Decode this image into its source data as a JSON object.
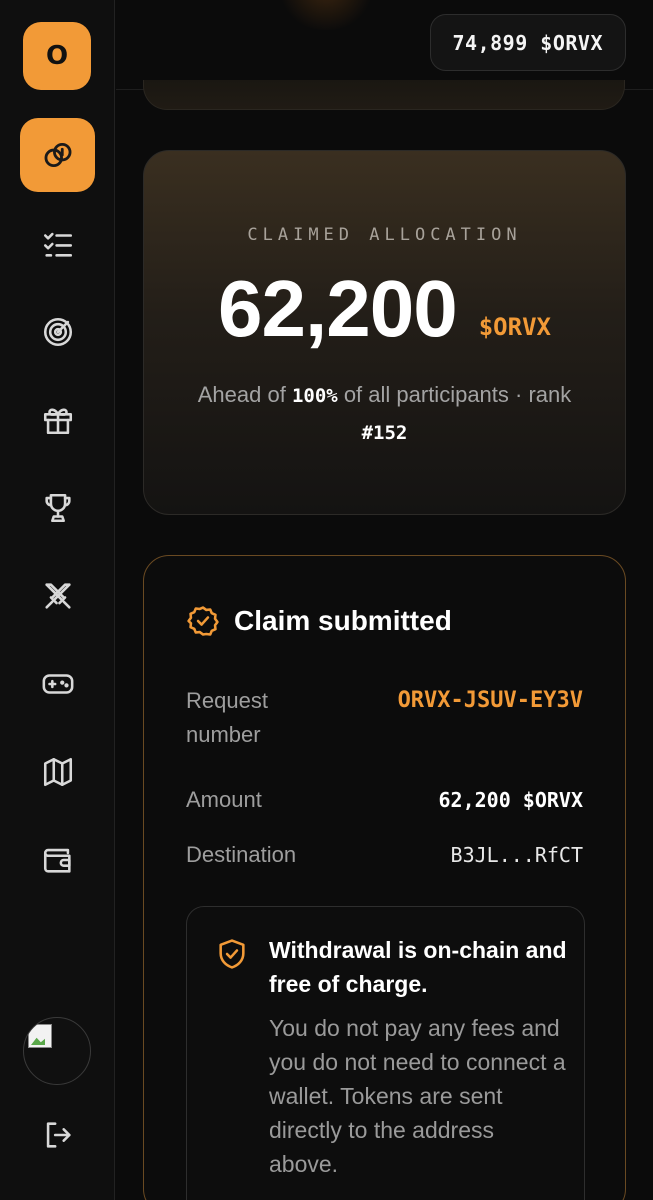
{
  "sidebar": {
    "logo_letter": "O",
    "nav": [
      {
        "icon": "link-coin-icon",
        "active": true
      },
      {
        "icon": "checklist-icon",
        "active": false
      },
      {
        "icon": "radar-icon",
        "active": false
      },
      {
        "icon": "gift-icon",
        "active": false
      },
      {
        "icon": "trophy-icon",
        "active": false
      },
      {
        "icon": "crossed-swords-icon",
        "active": false
      },
      {
        "icon": "gamepad-icon",
        "active": false
      },
      {
        "icon": "map-icon",
        "active": false
      },
      {
        "icon": "wallet-icon",
        "active": false
      }
    ],
    "logout_icon": "logout-icon"
  },
  "header": {
    "balance": "74,899 $ORVX"
  },
  "allocation": {
    "label": "CLAIMED ALLOCATION",
    "amount": "62,200",
    "unit": "$ORVX",
    "sub_prefix": "Ahead of ",
    "percent": "100%",
    "sub_middle": " of all participants · rank ",
    "rank": "#152"
  },
  "claim": {
    "title": "Claim submitted",
    "request_label": "Request number",
    "request_value": "ORVX-JSUV-EY3V",
    "amount_label": "Amount",
    "amount_value": "62,200 $ORVX",
    "destination_label": "Destination",
    "destination_value": "B3JL...RfCT",
    "info_title": "Withdrawal is on-chain and free of charge.",
    "info_body": "You do not pay any fees and you do not need to connect a wallet. Tokens are sent directly to the address above."
  },
  "colors": {
    "accent": "#f29a37",
    "background": "#0b0b0b",
    "muted_text": "#9e9e9e"
  }
}
